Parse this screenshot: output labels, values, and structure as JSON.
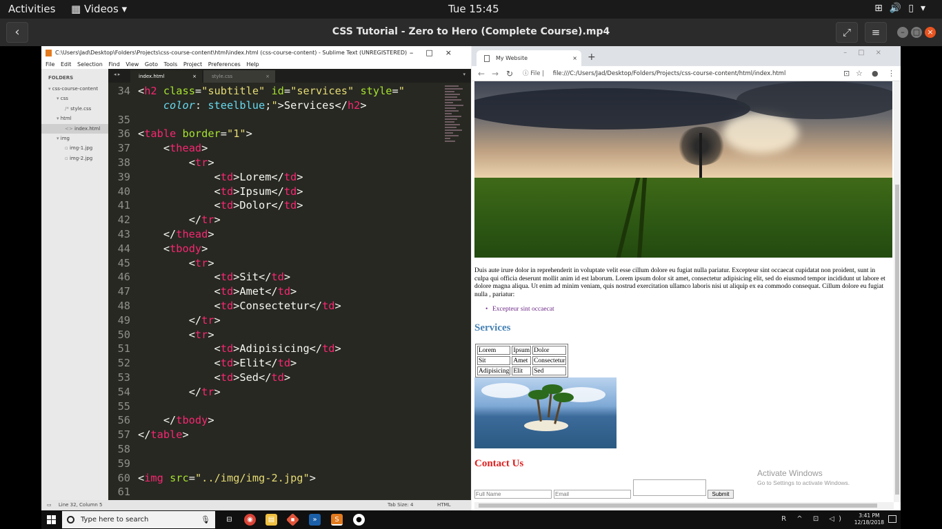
{
  "gnome": {
    "activities": "Activities",
    "app_name": "Videos",
    "clock": "Tue 15:45"
  },
  "player": {
    "title": "CSS Tutorial - Zero to Hero (Complete Course).mp4"
  },
  "sublime": {
    "window_title": "C:\\Users\\Jad\\Desktop\\Folders\\Projects\\css-course-content\\html\\index.html (css-course-content) - Sublime Text (UNREGISTERED)",
    "menu": [
      "File",
      "Edit",
      "Selection",
      "Find",
      "View",
      "Goto",
      "Tools",
      "Project",
      "Preferences",
      "Help"
    ],
    "sidebar_header": "FOLDERS",
    "tree": [
      {
        "label": "css-course-content",
        "indent": 0,
        "arrow": "▾"
      },
      {
        "label": "css",
        "indent": 1,
        "arrow": "▾"
      },
      {
        "label": "style.css",
        "indent": 2,
        "arrow": "/*"
      },
      {
        "label": "html",
        "indent": 1,
        "arrow": "▾"
      },
      {
        "label": "index.html",
        "indent": 2,
        "arrow": "<>",
        "selected": true
      },
      {
        "label": "img",
        "indent": 1,
        "arrow": "▾"
      },
      {
        "label": "img-1.jpg",
        "indent": 2,
        "arrow": "▫"
      },
      {
        "label": "img-2.jpg",
        "indent": 2,
        "arrow": "▫"
      }
    ],
    "tabs": [
      {
        "label": "index.html",
        "active": true
      },
      {
        "label": "style.css",
        "active": false
      }
    ],
    "code_lines": [
      {
        "n": "34",
        "html": "<span class='pn'>&lt;</span><span class='tg'>h2</span> <span class='at'>class</span><span class='pn'>=</span><span class='sv'>\"subtitle\"</span> <span class='at'>id</span><span class='pn'>=</span><span class='sv'>\"services\"</span> <span class='at'>style</span><span class='pn'>=</span><span class='sv'>\"</span>"
      },
      {
        "n": "",
        "html": "    <span class='cs'>color</span><span class='pn'>: </span><span class='cv'>steelblue</span><span class='pn'>;</span><span class='sv'>\"</span><span class='pn'>&gt;Services&lt;/</span><span class='tg'>h2</span><span class='pn'>&gt;</span>"
      },
      {
        "n": "35",
        "html": ""
      },
      {
        "n": "36",
        "html": "<span class='pn'>&lt;</span><span class='tg'>table</span> <span class='at'>border</span><span class='pn'>=</span><span class='sv'>\"1\"</span><span class='pn'>&gt;</span>"
      },
      {
        "n": "37",
        "html": "    <span class='pn'>&lt;</span><span class='tg'>thead</span><span class='pn'>&gt;</span>"
      },
      {
        "n": "38",
        "html": "        <span class='pn'>&lt;</span><span class='tg'>tr</span><span class='pn'>&gt;</span>"
      },
      {
        "n": "39",
        "html": "            <span class='pn'>&lt;</span><span class='tg'>td</span><span class='pn'>&gt;Lorem&lt;/</span><span class='tg'>td</span><span class='pn'>&gt;</span>"
      },
      {
        "n": "40",
        "html": "            <span class='pn'>&lt;</span><span class='tg'>td</span><span class='pn'>&gt;Ipsum&lt;/</span><span class='tg'>td</span><span class='pn'>&gt;</span>"
      },
      {
        "n": "41",
        "html": "            <span class='pn'>&lt;</span><span class='tg'>td</span><span class='pn'>&gt;Dolor&lt;/</span><span class='tg'>td</span><span class='pn'>&gt;</span>"
      },
      {
        "n": "42",
        "html": "        <span class='pn'>&lt;/</span><span class='tg'>tr</span><span class='pn'>&gt;</span>"
      },
      {
        "n": "43",
        "html": "    <span class='pn'>&lt;/</span><span class='tg'>thead</span><span class='pn'>&gt;</span>"
      },
      {
        "n": "44",
        "html": "    <span class='pn'>&lt;</span><span class='tg'>tbody</span><span class='pn'>&gt;</span>"
      },
      {
        "n": "45",
        "html": "        <span class='pn'>&lt;</span><span class='tg'>tr</span><span class='pn'>&gt;</span>"
      },
      {
        "n": "46",
        "html": "            <span class='pn'>&lt;</span><span class='tg'>td</span><span class='pn'>&gt;Sit&lt;/</span><span class='tg'>td</span><span class='pn'>&gt;</span>"
      },
      {
        "n": "47",
        "html": "            <span class='pn'>&lt;</span><span class='tg'>td</span><span class='pn'>&gt;Amet&lt;/</span><span class='tg'>td</span><span class='pn'>&gt;</span>"
      },
      {
        "n": "48",
        "html": "            <span class='pn'>&lt;</span><span class='tg'>td</span><span class='pn'>&gt;Consectetur&lt;/</span><span class='tg'>td</span><span class='pn'>&gt;</span>"
      },
      {
        "n": "49",
        "html": "        <span class='pn'>&lt;/</span><span class='tg'>tr</span><span class='pn'>&gt;</span>"
      },
      {
        "n": "50",
        "html": "        <span class='pn'>&lt;</span><span class='tg'>tr</span><span class='pn'>&gt;</span>"
      },
      {
        "n": "51",
        "html": "            <span class='pn'>&lt;</span><span class='tg'>td</span><span class='pn'>&gt;Adipisicing&lt;/</span><span class='tg'>td</span><span class='pn'>&gt;</span>"
      },
      {
        "n": "52",
        "html": "            <span class='pn'>&lt;</span><span class='tg'>td</span><span class='pn'>&gt;Elit&lt;/</span><span class='tg'>td</span><span class='pn'>&gt;</span>"
      },
      {
        "n": "53",
        "html": "            <span class='pn'>&lt;</span><span class='tg'>td</span><span class='pn'>&gt;Sed&lt;/</span><span class='tg'>td</span><span class='pn'>&gt;</span>"
      },
      {
        "n": "54",
        "html": "        <span class='pn'>&lt;/</span><span class='tg'>tr</span><span class='pn'>&gt;</span>"
      },
      {
        "n": "55",
        "html": ""
      },
      {
        "n": "56",
        "html": "    <span class='pn'>&lt;/</span><span class='tg'>tbody</span><span class='pn'>&gt;</span>"
      },
      {
        "n": "57",
        "html": "<span class='pn'>&lt;/</span><span class='tg'>table</span><span class='pn'>&gt;</span>"
      },
      {
        "n": "58",
        "html": ""
      },
      {
        "n": "59",
        "html": ""
      },
      {
        "n": "60",
        "html": "<span class='pn'>&lt;</span><span class='tg'>img</span> <span class='at'>src</span><span class='pn'>=</span><span class='sv'>\"../img/img-2.jpg\"</span><span class='pn'>&gt;</span>"
      },
      {
        "n": "61",
        "html": ""
      }
    ],
    "status_left": "Line 32, Column 5",
    "status_tab": "Tab Size: 4",
    "status_syntax": "HTML"
  },
  "chrome": {
    "tab_title": "My Website",
    "omnibox_label": "File",
    "url": "file:///C:/Users/Jad/Desktop/Folders/Projects/css-course-content/html/index.html"
  },
  "webpage": {
    "paragraph": "Duis aute irure dolor in reprehenderit in voluptate velit esse cillum dolore eu fugiat nulla pariatur. Excepteur sint occaecat cupidatat non proident, sunt in culpa qui officia deserunt mollit anim id est laborum. Lorem ipsum dolor sit amet, consectetur adipisicing elit, sed do eiusmod tempor incididunt ut labore et dolore magna aliqua. Ut enim ad minim veniam, quis nostrud exercitation ullamco laboris nisi ut aliquip ex ea commodo consequat. Cillum dolore eu fugiat nulla , pariatur:",
    "list_item": "Excepteur sint occaecat",
    "services_heading": "Services",
    "table_rows": [
      [
        "Lorem",
        "Ipsum",
        "Dolor"
      ],
      [
        "Sit",
        "Amet",
        "Consectetur"
      ],
      [
        "Adipisicing",
        "Elit",
        "Sed"
      ]
    ],
    "contact_heading": "Contact Us",
    "full_name_placeholder": "Full Name",
    "email_placeholder": "Email",
    "submit_label": "Submit",
    "services_color": "#4682b4",
    "contact_color": "#e02020"
  },
  "watermark": {
    "title": "Activate Windows",
    "subtitle": "Go to Settings to activate Windows."
  },
  "taskbar": {
    "search_placeholder": "Type here to search",
    "time": "3:41 PM",
    "date": "12/18/2018"
  }
}
